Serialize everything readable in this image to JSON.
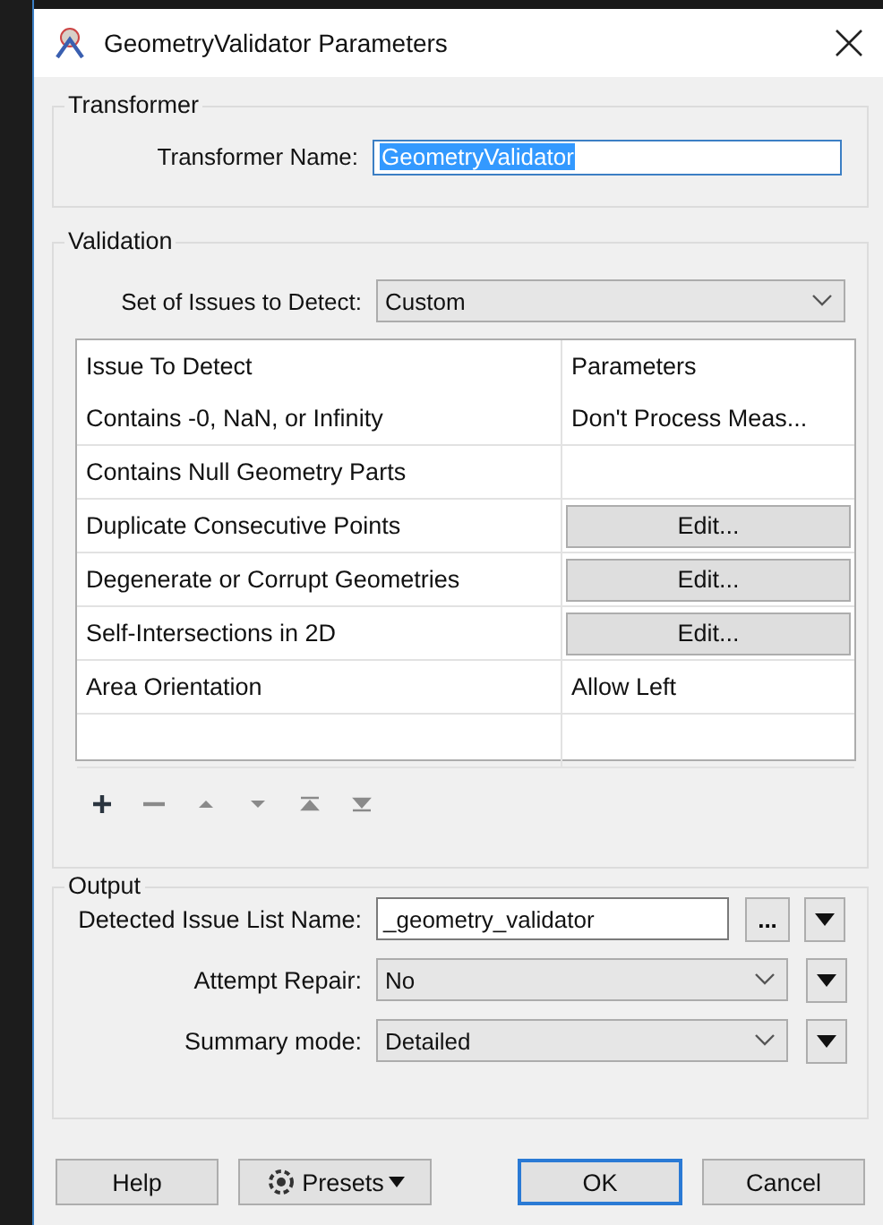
{
  "window": {
    "title": "GeometryValidator Parameters"
  },
  "transformer": {
    "legend": "Transformer",
    "name_label": "Transformer Name:",
    "name_value": "GeometryValidator",
    "value_selected": true
  },
  "validation": {
    "legend": "Validation",
    "issue_set_label": "Set of Issues to Detect:",
    "issue_set_value": "Custom",
    "table": {
      "columns": [
        "Issue To Detect",
        "Parameters"
      ],
      "rows": [
        {
          "issue": "Contains -0, NaN, or Infinity",
          "kind": "text",
          "parameter": "Don't Process Meas..."
        },
        {
          "issue": "Contains Null Geometry Parts",
          "kind": "empty"
        },
        {
          "issue": "Duplicate Consecutive Points",
          "kind": "button",
          "parameter": "Edit..."
        },
        {
          "issue": "Degenerate or Corrupt Geometries",
          "kind": "button",
          "parameter": "Edit..."
        },
        {
          "issue": "Self-Intersections in 2D",
          "kind": "button",
          "parameter": "Edit..."
        },
        {
          "issue": "Area Orientation",
          "kind": "text",
          "parameter": "Allow Left"
        }
      ]
    },
    "toolbar": [
      {
        "kind": "add",
        "disabled": false
      },
      {
        "kind": "remove",
        "disabled": true
      },
      {
        "kind": "up",
        "disabled": true
      },
      {
        "kind": "down",
        "disabled": true
      },
      {
        "kind": "top",
        "disabled": true
      },
      {
        "kind": "bottom",
        "disabled": true
      }
    ]
  },
  "output": {
    "legend": "Output",
    "fields": [
      {
        "label": "Detected Issue List Name:",
        "kind": "text",
        "value": "_geometry_validator",
        "browse": "..."
      },
      {
        "label": "Attempt Repair:",
        "kind": "dropdown",
        "value": "No"
      },
      {
        "label": "Summary mode:",
        "kind": "dropdown",
        "value": "Detailed"
      }
    ]
  },
  "buttons": [
    {
      "label": "Help",
      "kind": "plain",
      "default": false
    },
    {
      "label": "Presets",
      "kind": "menu",
      "default": false
    },
    {
      "label": "OK",
      "kind": "plain",
      "default": true
    },
    {
      "label": "Cancel",
      "kind": "plain",
      "default": false
    }
  ]
}
